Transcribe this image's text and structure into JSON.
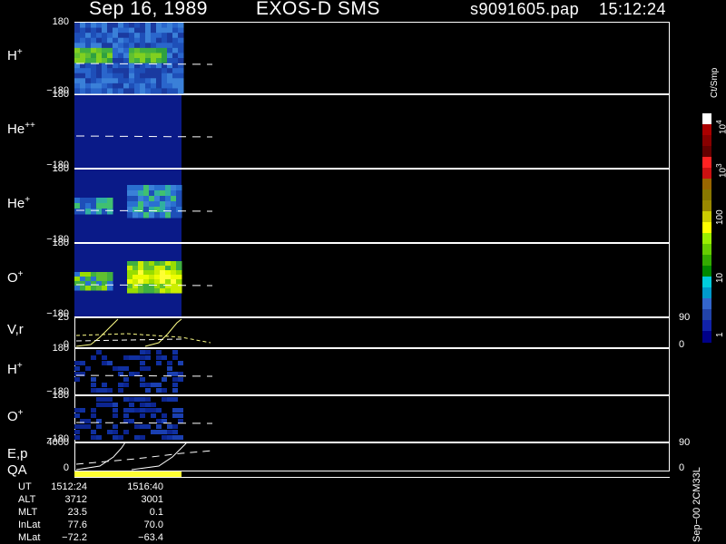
{
  "header": {
    "date": "Sep 16, 1989",
    "instrument": "EXOS-D SMS",
    "file": "s9091605.pap",
    "time": "15:12:24"
  },
  "panels": [
    {
      "label_base": "H",
      "label_sup": "+",
      "ymax": "180",
      "ymin": "−180"
    },
    {
      "label_base": "He",
      "label_sup": "++",
      "ymax": "180",
      "ymin": "−180"
    },
    {
      "label_base": "He",
      "label_sup": "+",
      "ymax": "180",
      "ymin": "−180"
    },
    {
      "label_base": "O",
      "label_sup": "+",
      "ymax": "180",
      "ymin": "−180"
    },
    {
      "label_base": "V,r",
      "label_sup": "",
      "ymax": "25",
      "ymin": "0",
      "right_top": "90",
      "right_bottom": "0"
    },
    {
      "label_base": "H",
      "label_sup": "+",
      "ymax": "180",
      "ymin": "−180"
    },
    {
      "label_base": "O",
      "label_sup": "+",
      "ymax": "180",
      "ymin": "−180"
    },
    {
      "label_base": "E,p",
      "label_sup": "",
      "ymax": "4000",
      "ymin": "0",
      "right_top": "90",
      "right_bottom": "0"
    }
  ],
  "qa_label": "QA",
  "colorbar": {
    "unit": "Ct/Smp",
    "ticks": [
      "1",
      "10",
      "100",
      "10",
      "10"
    ],
    "tick_sups": [
      "",
      "",
      "",
      "3",
      "4"
    ],
    "colors": [
      "#ffffff",
      "#aa0000",
      "#880000",
      "#660000",
      "#ff2222",
      "#cc1111",
      "#996600",
      "#887700",
      "#998800",
      "#cccc00",
      "#ffff00",
      "#99ee00",
      "#66cc00",
      "#33aa00",
      "#008800",
      "#00ccdd",
      "#0099cc",
      "#3366cc",
      "#2244aa",
      "#1122aa",
      "#000088"
    ]
  },
  "footer": {
    "labels": [
      "UT",
      "ALT",
      "MLT",
      "InLat",
      "MLat"
    ],
    "col1": [
      "1512:24",
      "3712",
      "23.5",
      "77.6",
      "−72.2"
    ],
    "col2": [
      "1516:40",
      "3001",
      "0.1",
      "70.0",
      "−63.4"
    ],
    "side_label": "Sep−00 2CM33L"
  },
  "chart_data": {
    "type": "heatmap",
    "title": "Sep 16, 1989   EXOS-D SMS",
    "colorbar_unit": "Ct/Smp",
    "colorbar_ticks": [
      "1",
      "10",
      "100",
      "10^3",
      "10^4"
    ],
    "time_range": [
      "1512:24",
      "1516:40"
    ],
    "panels": [
      "H+",
      "He++",
      "He+",
      "O+",
      "V,r",
      "H+",
      "O+",
      "E,p",
      "QA"
    ],
    "y_ranges": {
      "H+": [
        -180,
        180
      ],
      "He++": [
        -180,
        180
      ],
      "He+": [
        -180,
        180
      ],
      "O+": [
        -180,
        180
      ],
      "V,r": [
        0,
        25
      ],
      "E,p": [
        0,
        4000
      ]
    }
  }
}
